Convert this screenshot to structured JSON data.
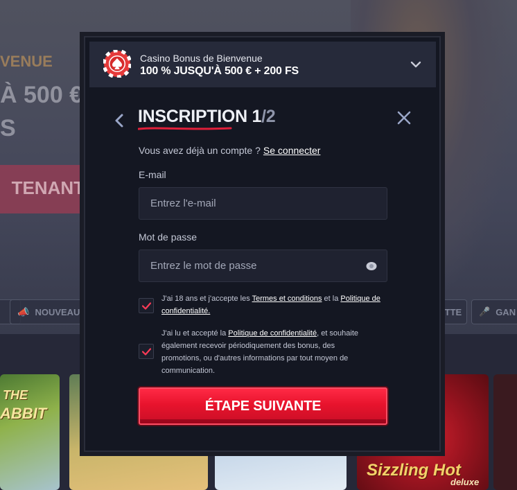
{
  "background": {
    "hero_line": "VENUE",
    "hero_big_1": "À 500 €",
    "hero_big_2": "S",
    "hero_button": "TENANT",
    "chips": [
      "NOUVEAU",
      "ETTE",
      "GAN"
    ],
    "tiles": [
      "THE",
      "ABBIT",
      "Sizzling Hot",
      "deluxe"
    ]
  },
  "bonus": {
    "title": "Casino Bonus de Bienvenue",
    "value": "100 % JUSQU'À 500 € + 200 FS"
  },
  "form": {
    "title": "INSCRIPTION",
    "step_current": "1",
    "step_sep": "/",
    "step_total": "2",
    "have_account_text": "Vous avez déjà un compte ?",
    "login_link": "Se connecter",
    "email_label": "E-mail",
    "email_placeholder": "Entrez l'e-mail",
    "password_label": "Mot de passe",
    "password_placeholder": "Entrez le mot de passe",
    "terms": {
      "checked": true,
      "pre": "J'ai 18 ans et j'accepte les ",
      "link1": "Termes et conditions",
      "mid": " et la ",
      "link2": "Politique de confidentialité."
    },
    "marketing": {
      "checked": true,
      "pre": "J'ai lu et accepté la ",
      "link": "Politique de confidentialité",
      "post": ", et souhaite également recevoir périodiquement des bonus, des promotions, ou d'autres informations par tout moyen de communication."
    },
    "submit_label": "ÉTAPE SUIVANTE"
  },
  "colors": {
    "accent_red": "#e8132d",
    "modal_bg": "#141722",
    "bonus_bar_bg": "#262a3a"
  },
  "icons": {
    "chip": "poker-chip-spade-icon",
    "chevron": "chevron-down-icon",
    "back": "chevron-left-icon",
    "close": "close-icon",
    "eye": "eye-icon",
    "check": "checkmark-icon"
  }
}
